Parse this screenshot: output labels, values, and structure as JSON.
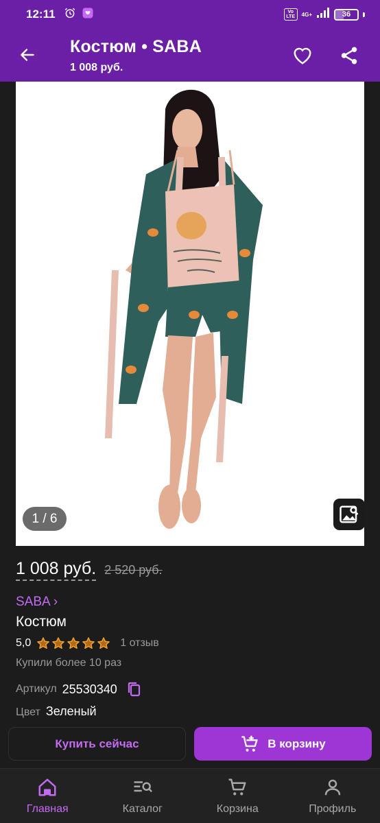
{
  "status_bar": {
    "time": "12:11",
    "volte": "Vo LTE",
    "network": "4G+",
    "battery": "36",
    "battery_level": 0.36
  },
  "header": {
    "title": "Костюм • SABA",
    "subtitle": "1 008 руб."
  },
  "gallery": {
    "counter": "1 / 6"
  },
  "product": {
    "price_current": "1 008 руб.",
    "price_old": "2 520 руб.",
    "brand": "SABA ›",
    "name": "Костюм",
    "rating": "5,0",
    "stars": 5,
    "reviews": "1 отзыв",
    "bought": "Купили более 10 раз",
    "article_label": "Артикул",
    "article_value": "25530340",
    "color_label": "Цвет",
    "color_value": "Зеленый"
  },
  "actions": {
    "buy_now": "Купить сейчас",
    "to_cart": "В корзину"
  },
  "nav": {
    "items": [
      {
        "label": "Главная",
        "icon": "home-icon",
        "active": true
      },
      {
        "label": "Каталог",
        "icon": "catalog-search-icon",
        "active": false
      },
      {
        "label": "Корзина",
        "icon": "cart-icon",
        "active": false
      },
      {
        "label": "Профиль",
        "icon": "profile-icon",
        "active": false
      }
    ]
  },
  "colors": {
    "brand_purple": "#6a1fa6",
    "accent_purple": "#c36bf2",
    "button_purple": "#9e36d6",
    "star_orange": "#f2a12e",
    "background": "#1c1c1c"
  }
}
